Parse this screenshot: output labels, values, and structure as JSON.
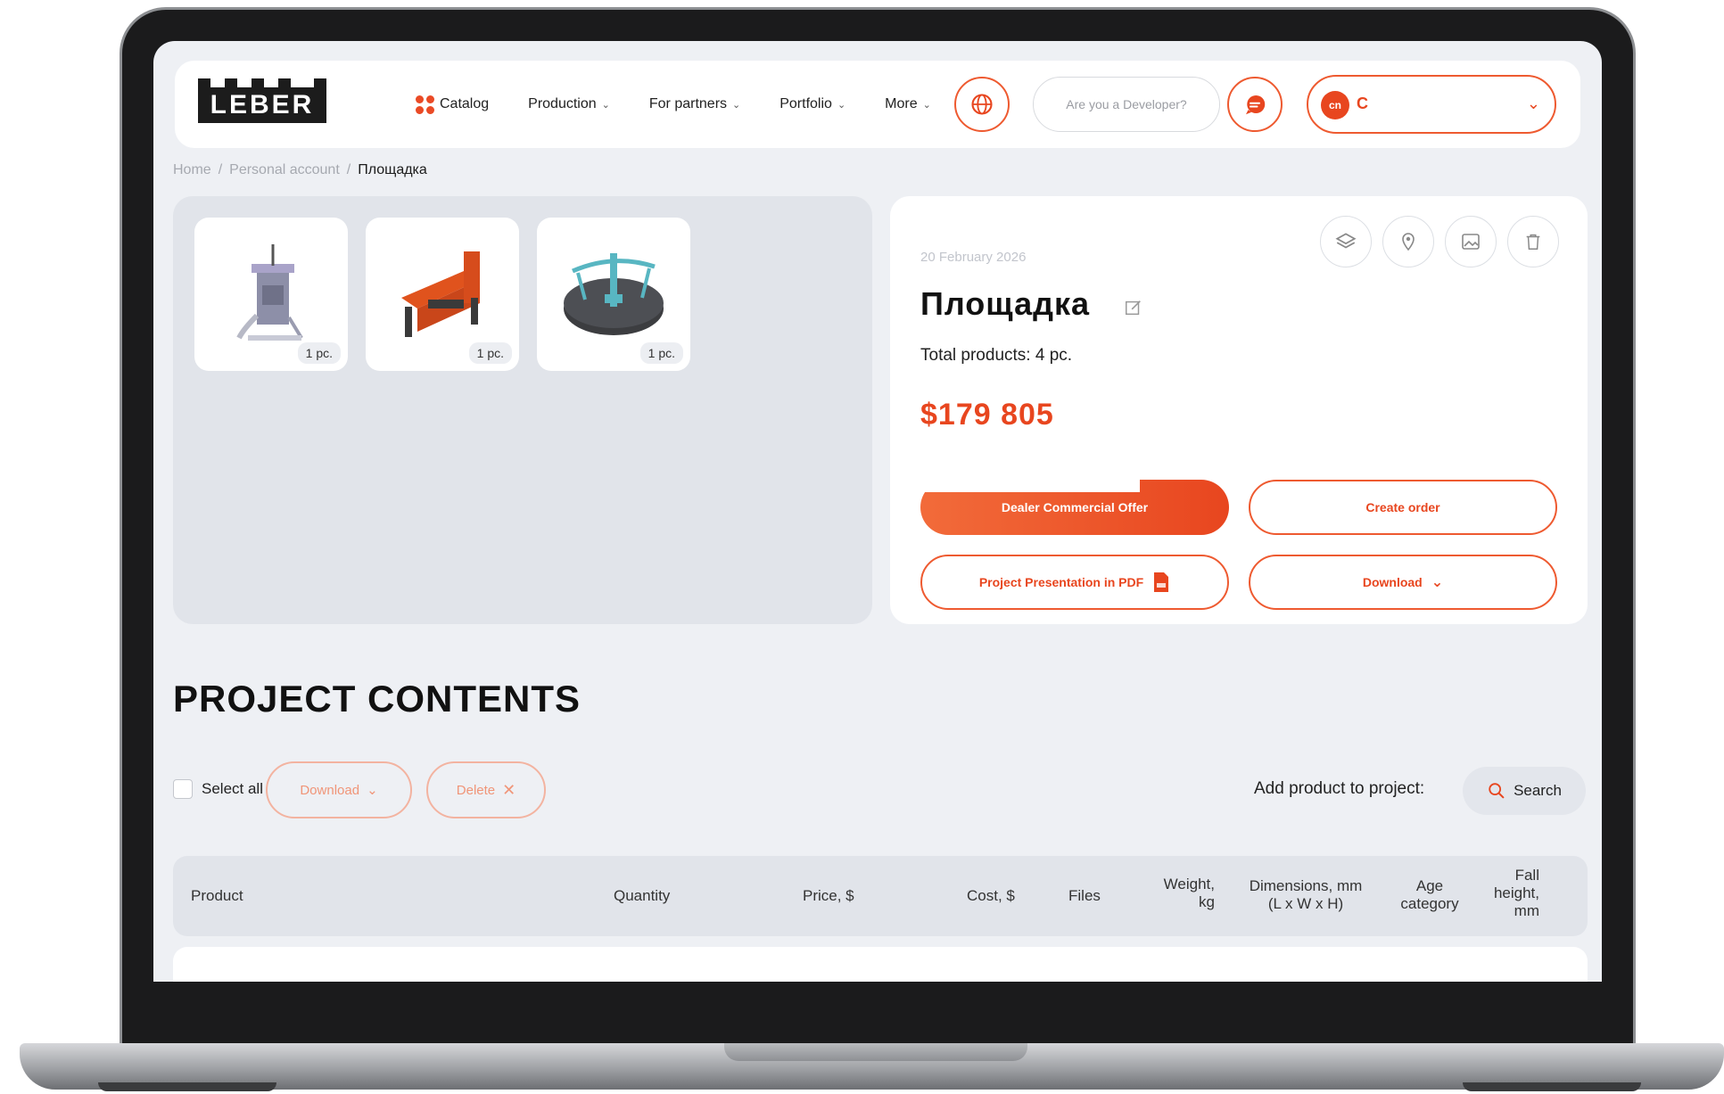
{
  "header": {
    "logo_text": "LEBER",
    "nav": [
      {
        "label": "Catalog"
      },
      {
        "label": "Production"
      },
      {
        "label": "For partners"
      },
      {
        "label": "Portfolio"
      },
      {
        "label": "More"
      }
    ],
    "developer_prompt": "Are you a Developer?",
    "account_avatar_text": "cn",
    "account_initial": "C"
  },
  "breadcrumb": {
    "items": [
      "Home",
      "Personal account",
      "Площадка"
    ],
    "separator": "/"
  },
  "gallery": {
    "thumbs": [
      {
        "qty": "1 pc."
      },
      {
        "qty": "1 pc."
      },
      {
        "qty": "1 pc."
      }
    ]
  },
  "project": {
    "date": "20 February 2026",
    "title": "Площадка",
    "total": "Total products: 4 pc.",
    "price": "$179 805",
    "buttons": {
      "dealer_offer": "Dealer Commercial Offer",
      "create_order": "Create order",
      "presentation": "Project Presentation in PDF",
      "download": "Download"
    }
  },
  "contents": {
    "title": "PROJECT CONTENTS",
    "select_all": "Select all",
    "download": "Download",
    "delete": "Delete",
    "add_product": "Add product to project:",
    "search": "Search"
  },
  "table": {
    "headers": {
      "product": "Product",
      "quantity": "Quantity",
      "price": "Price, $",
      "cost": "Cost, $",
      "files": "Files",
      "weight_1": "Weight,",
      "weight_2": "kg",
      "dimensions_1": "Dimensions, mm",
      "dimensions_2": "(L x W x H)",
      "age_1": "Age",
      "age_2": "category",
      "fall_1": "Fall",
      "fall_2": "height,",
      "fall_3": "mm"
    }
  },
  "colors": {
    "accent": "#e8461f",
    "page_bg": "#eef0f4",
    "panel": "#e1e4ea"
  }
}
